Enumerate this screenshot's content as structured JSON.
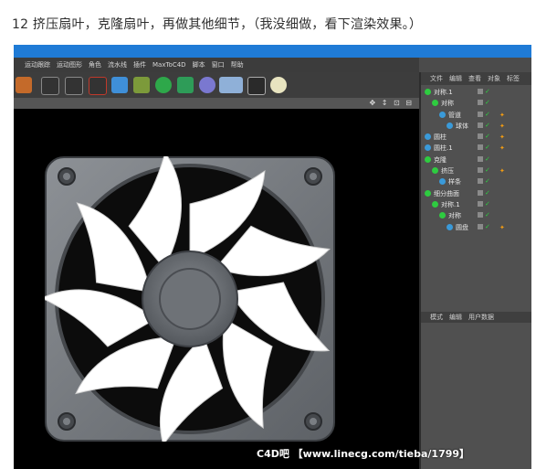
{
  "caption": {
    "number": "12",
    "text": "挤压扇叶，克隆扇叶，再做其他细节，（我没细做，看下渲染效果。）"
  },
  "menu": [
    "运动跟踪",
    "运动图形",
    "角色",
    "流水线",
    "插件",
    "MaxToC4D",
    "脚本",
    "窗口",
    "帮助"
  ],
  "toolbar_icons": [
    "film-icon",
    "clapper-icon",
    "clapper-gear-icon",
    "cube-icon",
    "pen-icon",
    "sphere-icon",
    "gear-icon",
    "capsule-icon",
    "grid-icon",
    "camera-icon",
    "light-icon"
  ],
  "viewport_nav": "✥ ↕ ⊡ ⊟",
  "object_tabs": [
    "文件",
    "编辑",
    "查看",
    "对象",
    "标签"
  ],
  "objects": [
    {
      "label": "对称.1",
      "indent": 0,
      "color": "#2ecc40",
      "tags": false
    },
    {
      "label": "对称",
      "indent": 1,
      "color": "#2ecc40",
      "tags": false
    },
    {
      "label": "管道",
      "indent": 2,
      "color": "#3a9ad9",
      "tags": true
    },
    {
      "label": "球体",
      "indent": 3,
      "color": "#3a9ad9",
      "tags": true
    },
    {
      "label": "圆柱",
      "indent": 0,
      "color": "#3a9ad9",
      "tags": true
    },
    {
      "label": "圆柱.1",
      "indent": 0,
      "color": "#3a9ad9",
      "tags": true
    },
    {
      "label": "克隆",
      "indent": 0,
      "color": "#2ecc40",
      "tags": false
    },
    {
      "label": "挤压",
      "indent": 1,
      "color": "#2ecc40",
      "tags": true
    },
    {
      "label": "样条",
      "indent": 2,
      "color": "#3a9ad9",
      "tags": false
    },
    {
      "label": "细分曲面",
      "indent": 0,
      "color": "#2ecc40",
      "tags": false
    },
    {
      "label": "对称.1",
      "indent": 1,
      "color": "#2ecc40",
      "tags": false
    },
    {
      "label": "对称",
      "indent": 2,
      "color": "#2ecc40",
      "tags": false
    },
    {
      "label": "圆盘",
      "indent": 3,
      "color": "#3a9ad9",
      "tags": true
    }
  ],
  "attribute_tabs": [
    "模式",
    "编辑",
    "用户数据"
  ],
  "watermark": "C4D吧 【www.linecg.com/tieba/1799】",
  "colors": {
    "titlebar": "#1f7bd6",
    "viewport_bg": "#000000",
    "panel_bg": "#505050",
    "enabled_check": "#2ecc40",
    "tag_orange": "#f39c12"
  }
}
